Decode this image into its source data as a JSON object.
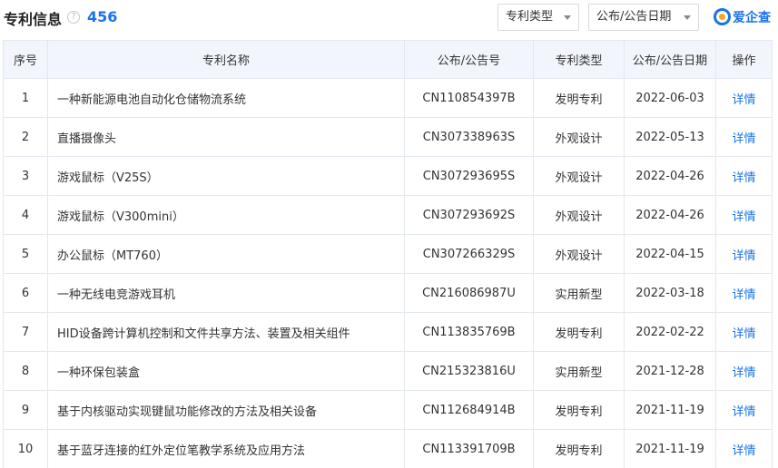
{
  "header": {
    "title": "专利信息",
    "help_icon": "question-circle-icon",
    "count": "456",
    "filters": [
      {
        "label": "专利类型"
      },
      {
        "label": "公布/公告日期"
      }
    ],
    "brand": {
      "text": "爱企查",
      "color": "#1a73e8"
    }
  },
  "table": {
    "columns": [
      "序号",
      "专利名称",
      "公布/公告号",
      "专利类型",
      "公布/公告日期",
      "操作"
    ],
    "rows": [
      {
        "no": "1",
        "name": "一种新能源电池自动化仓储物流系统",
        "number": "CN110854397B",
        "type": "发明专利",
        "date": "2022-06-03",
        "action": "详情"
      },
      {
        "no": "2",
        "name": "直播摄像头",
        "number": "CN307338963S",
        "type": "外观设计",
        "date": "2022-05-13",
        "action": "详情"
      },
      {
        "no": "3",
        "name": "游戏鼠标（V25S）",
        "number": "CN307293695S",
        "type": "外观设计",
        "date": "2022-04-26",
        "action": "详情"
      },
      {
        "no": "4",
        "name": "游戏鼠标（V300mini）",
        "number": "CN307293692S",
        "type": "外观设计",
        "date": "2022-04-26",
        "action": "详情"
      },
      {
        "no": "5",
        "name": "办公鼠标（MT760）",
        "number": "CN307266329S",
        "type": "外观设计",
        "date": "2022-04-15",
        "action": "详情"
      },
      {
        "no": "6",
        "name": "一种无线电竞游戏耳机",
        "number": "CN216086987U",
        "type": "实用新型",
        "date": "2022-03-18",
        "action": "详情"
      },
      {
        "no": "7",
        "name": "HID设备跨计算机控制和文件共享方法、装置及相关组件",
        "number": "CN113835769B",
        "type": "发明专利",
        "date": "2022-02-22",
        "action": "详情"
      },
      {
        "no": "8",
        "name": "一种环保包装盒",
        "number": "CN215323816U",
        "type": "实用新型",
        "date": "2021-12-28",
        "action": "详情"
      },
      {
        "no": "9",
        "name": "基于内核驱动实现键鼠功能修改的方法及相关设备",
        "number": "CN112684914B",
        "type": "发明专利",
        "date": "2021-11-19",
        "action": "详情"
      },
      {
        "no": "10",
        "name": "基于蓝牙连接的红外定位笔教学系统及应用方法",
        "number": "CN113391709B",
        "type": "发明专利",
        "date": "2021-11-19",
        "action": "详情"
      }
    ]
  }
}
